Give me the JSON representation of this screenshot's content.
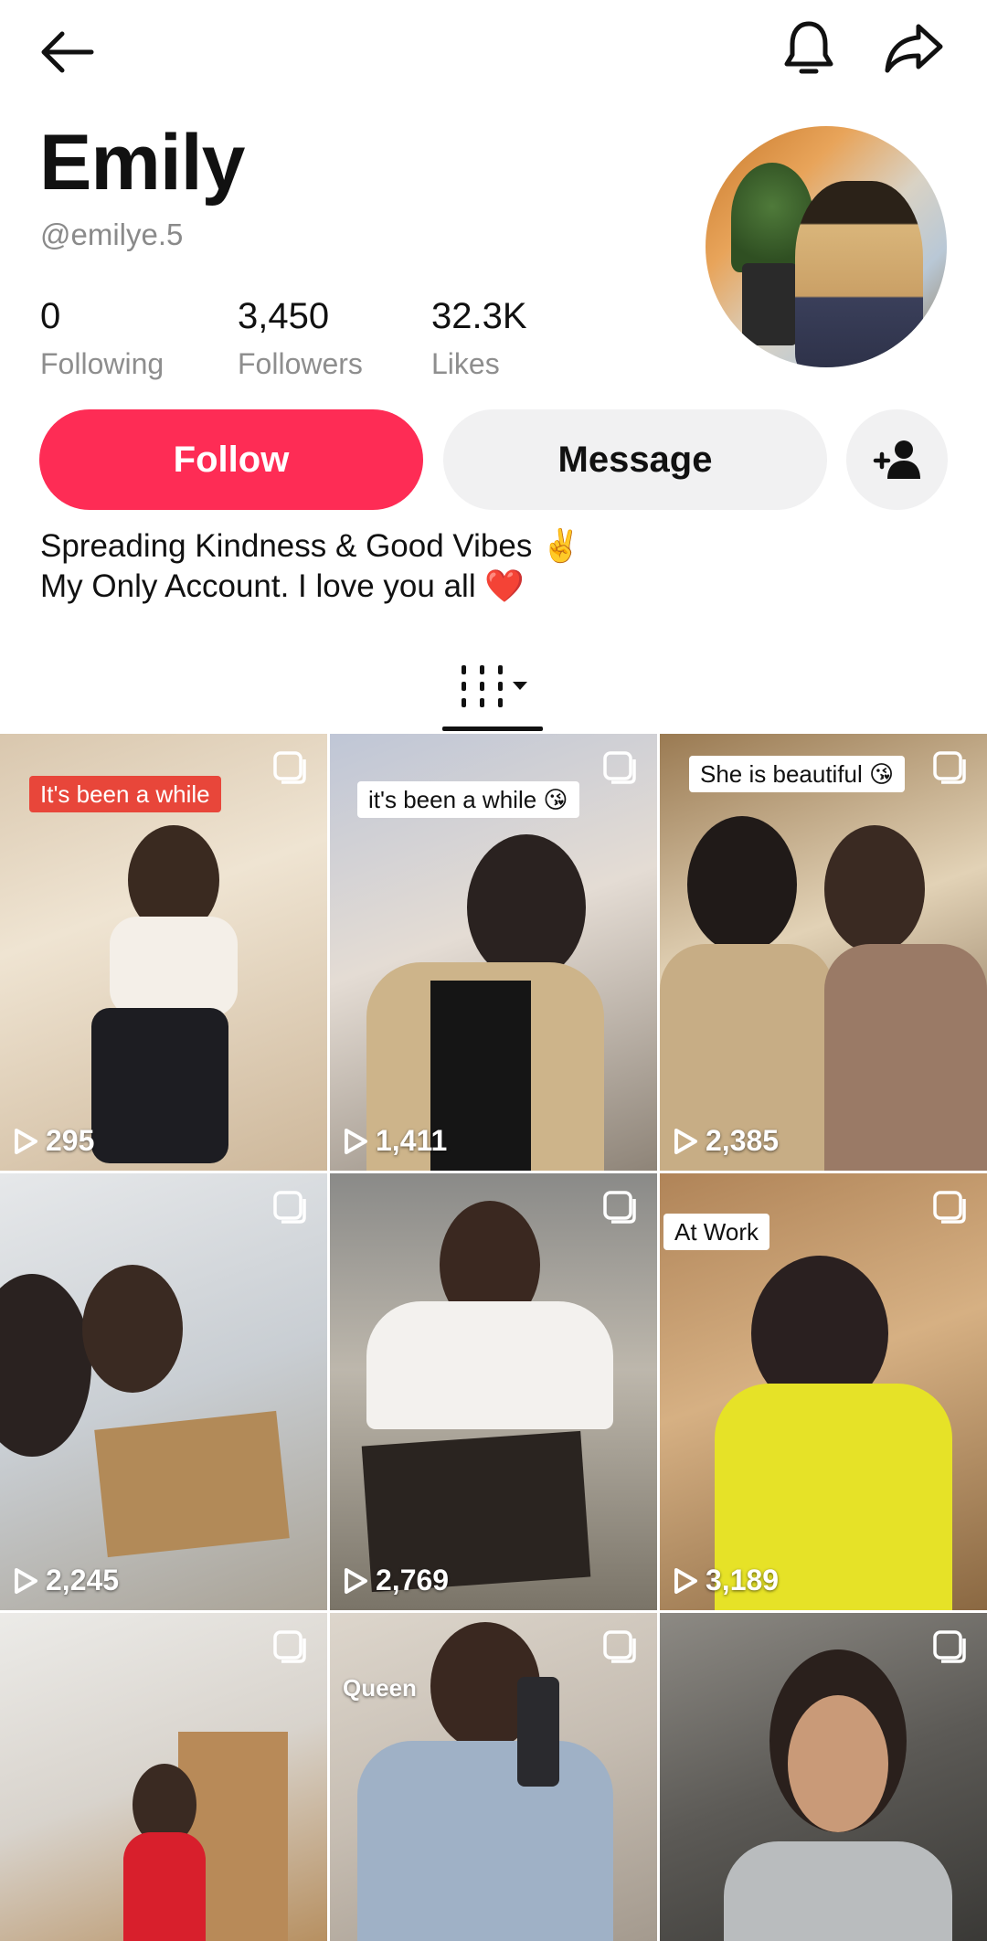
{
  "profile": {
    "name": "Emily",
    "handle": "@emilye.5",
    "stats": [
      {
        "value": "0",
        "label": "Following"
      },
      {
        "value": "3,450",
        "label": "Followers"
      },
      {
        "value": "32.3K",
        "label": "Likes"
      }
    ],
    "bio": [
      "Spreading Kindness & Good Vibes ✌️",
      "My Only Account. I love you all ❤️"
    ]
  },
  "actions": {
    "follow_label": "Follow",
    "message_label": "Message"
  },
  "icons": {
    "back": "arrow-left-icon",
    "notifications": "bell-icon",
    "share": "share-icon",
    "add_friend": "add-user-icon",
    "grid_tab": "grid-icon"
  },
  "colors": {
    "follow": "#fe2c55",
    "secondary_button": "#f1f1f2",
    "caption_red": "#e8463a"
  },
  "videos": [
    {
      "caption": "It's been a while",
      "views": "295"
    },
    {
      "caption": "it's been a while 😘",
      "views": "1,411"
    },
    {
      "caption": "She is beautiful 😘",
      "views": "2,385"
    },
    {
      "caption": "",
      "views": "2,245"
    },
    {
      "caption": "",
      "views": "2,769"
    },
    {
      "caption": "At Work",
      "views": "3,189"
    },
    {
      "caption": "",
      "views": ""
    },
    {
      "caption": "Queen",
      "views": ""
    },
    {
      "caption": "",
      "views": ""
    }
  ]
}
